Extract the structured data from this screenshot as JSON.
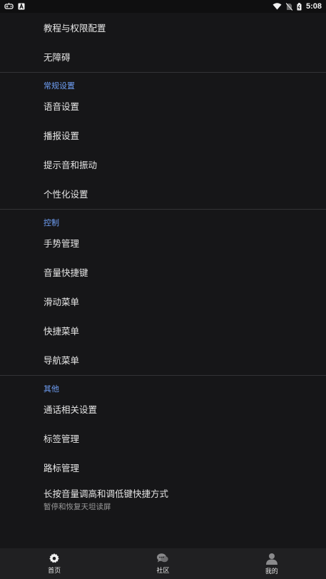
{
  "status_bar": {
    "time": "5:08",
    "left_icons": [
      "gamepad-icon",
      "a-badge-icon"
    ],
    "right_icons": [
      "wifi-icon",
      "no-sim-icon",
      "battery-charging-icon"
    ]
  },
  "list": {
    "items_top": [
      {
        "label": "教程与权限配置"
      },
      {
        "label": "无障碍"
      }
    ],
    "section_general": {
      "header": "常规设置",
      "items": [
        {
          "label": "语音设置"
        },
        {
          "label": "播报设置"
        },
        {
          "label": "提示音和振动"
        },
        {
          "label": "个性化设置"
        }
      ]
    },
    "section_control": {
      "header": "控制",
      "items": [
        {
          "label": "手势管理"
        },
        {
          "label": "音量快捷键"
        },
        {
          "label": "滑动菜单"
        },
        {
          "label": "快捷菜单"
        },
        {
          "label": "导航菜单"
        }
      ]
    },
    "section_other": {
      "header": "其他",
      "items": [
        {
          "label": "通话相关设置"
        },
        {
          "label": "标签管理"
        },
        {
          "label": "路标管理"
        },
        {
          "label": "长按音量调高和调低键快捷方式",
          "sub": "暂停和恢复天坦读屏"
        }
      ]
    }
  },
  "bottom_nav": {
    "items": [
      {
        "label": "首页",
        "icon": "home-gear-icon"
      },
      {
        "label": "社区",
        "icon": "chat-bubbles-icon"
      },
      {
        "label": "我的",
        "icon": "person-icon"
      }
    ]
  },
  "colors": {
    "background": "#161618",
    "section_header": "#6f9ff5",
    "divider": "#333336",
    "nav_background": "#202022"
  }
}
